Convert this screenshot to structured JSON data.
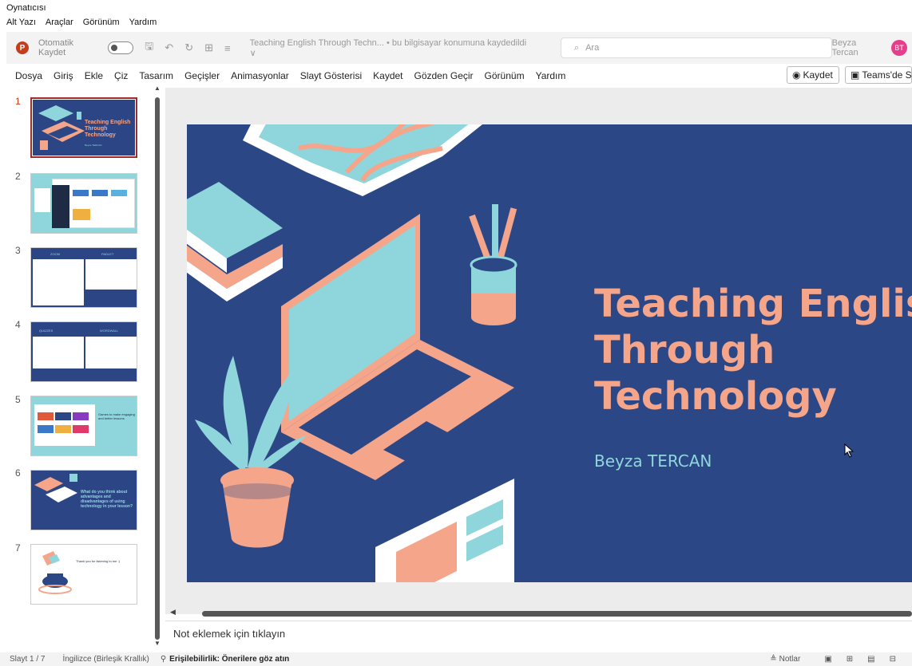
{
  "host": {
    "title": "Oynatıcısı",
    "menu": [
      "Alt Yazı",
      "Araçlar",
      "Görünüm",
      "Yardım"
    ]
  },
  "titlebar": {
    "autosave_label": "Otomatik Kaydet",
    "doc_title": "Teaching English Through Techn... • bu bilgisayar konumuna kaydedildi ∨",
    "search_placeholder": "Ara",
    "user_name": "Beyza Tercan",
    "user_initials": "BT"
  },
  "ribbon": {
    "tabs": [
      "Dosya",
      "Giriş",
      "Ekle",
      "Çiz",
      "Tasarım",
      "Geçişler",
      "Animasyonlar",
      "Slayt Gösterisi",
      "Kaydet",
      "Gözden Geçir",
      "Görünüm",
      "Yardım"
    ],
    "record_button": "Kaydet",
    "teams_button": "Teams'de Su"
  },
  "thumbnails": [
    {
      "num": "1",
      "title": "Teaching English Through Technology",
      "subtitle": "Beyza TERCAN"
    },
    {
      "num": "2"
    },
    {
      "num": "3",
      "left_heading": "ZOOM",
      "right_heading": "PADLET"
    },
    {
      "num": "4",
      "left_heading": "QUIZZES",
      "right_heading": "WORDWALL"
    },
    {
      "num": "5",
      "text": "Games to make engaging and better lessons"
    },
    {
      "num": "6",
      "text": "What do you think about advantages and disadvantages of using technology in your lesson?"
    },
    {
      "num": "7",
      "text": "Thank you for listening to me :)"
    }
  ],
  "slide": {
    "title": "Teaching English\nThrough\nTechnology",
    "author": "Beyza TERCAN"
  },
  "notes_placeholder": "Not eklemek için tıklayın",
  "status": {
    "slide_info": "Slayt 1 / 7",
    "language": "İngilizce (Birleşik Krallık)",
    "accessibility": "Erişilebilirlik: Önerilere göz atın",
    "notes_label": "Notlar"
  },
  "colors": {
    "slide_bg": "#2c4785",
    "title_color": "#f4a58a",
    "accent_teal": "#8fd6dc",
    "active_thumb": "#a52a2a"
  }
}
